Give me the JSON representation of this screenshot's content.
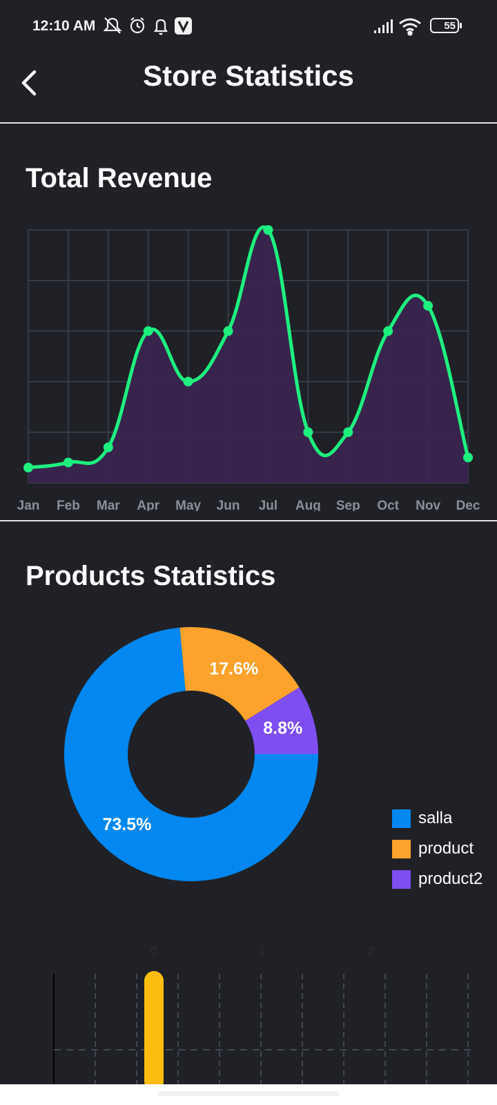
{
  "status_bar": {
    "time": "12:10 AM",
    "battery": "55",
    "icons": [
      "mute-icon",
      "alarm-icon",
      "notification-bell-icon",
      "v-app-icon",
      "signal-icon",
      "wifi-icon",
      "battery-icon"
    ]
  },
  "app_bar": {
    "title": "Store Statistics",
    "back_icon": "chevron-left-icon"
  },
  "revenue_section": {
    "title": "Total Revenue"
  },
  "products_section": {
    "title": "Products Statistics"
  },
  "colors": {
    "background": "#202126",
    "line": "#1ef07f",
    "area_fill": "#3b2352",
    "grid": "#3a4450",
    "salla": "#0288f0",
    "product": "#fda22c",
    "product2": "#7e4ef1",
    "bar": "#fdbd10"
  },
  "chart_data": [
    {
      "type": "area",
      "title": "Total Revenue",
      "categories": [
        "Jan",
        "Feb",
        "Mar",
        "Apr",
        "May",
        "Jun",
        "Jul",
        "Aug",
        "Sep",
        "Oct",
        "Nov",
        "Dec"
      ],
      "values": [
        0.3,
        0.4,
        0.7,
        3.0,
        2.0,
        3.0,
        5.0,
        1.0,
        1.0,
        3.0,
        3.5,
        0.5
      ],
      "ylim": [
        0,
        5
      ],
      "grid": true,
      "smooth": true,
      "ytick_labels_visible": false
    },
    {
      "type": "pie",
      "title": "Products Statistics",
      "donut": true,
      "slices": [
        {
          "label": "salla",
          "value": 73.5,
          "display": "73.5%"
        },
        {
          "label": "product",
          "value": 17.6,
          "display": "17.6%"
        },
        {
          "label": "product2",
          "value": 8.8,
          "display": "8.8%"
        }
      ],
      "legend_position": "right"
    },
    {
      "type": "bar",
      "categories": [
        "0",
        "1",
        "2"
      ],
      "values": [
        1
      ],
      "grid": true,
      "partially_visible": true
    }
  ]
}
